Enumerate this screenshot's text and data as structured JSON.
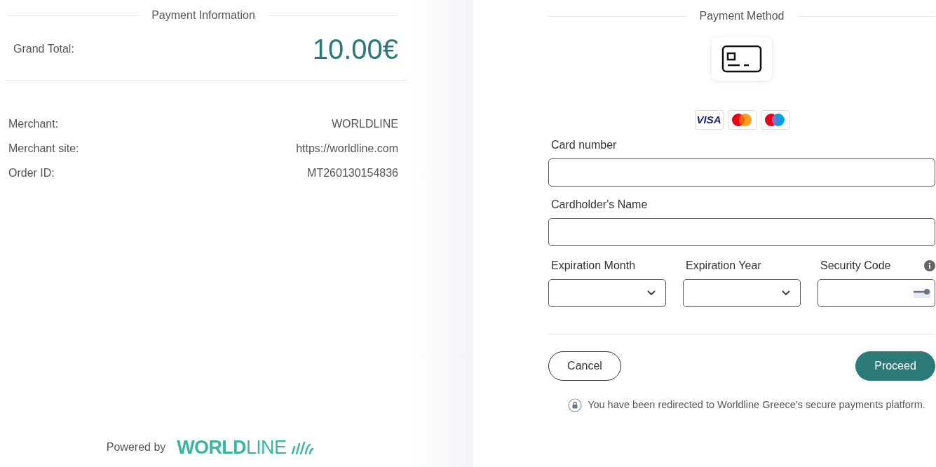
{
  "payment_information": {
    "heading": "Payment Information",
    "grand_total": {
      "label": "Grand Total:",
      "amount": "10.00€"
    },
    "details": [
      {
        "label": "Merchant:",
        "value": "WORLDLINE"
      },
      {
        "label": "Merchant site:",
        "value": "https://worldline.com"
      },
      {
        "label": "Order ID:",
        "value": "MT260130154836"
      }
    ],
    "footer": {
      "prefix": "Powered by",
      "logo": "**WORLD**LINE"
    }
  },
  "payment_method": {
    "heading": "Payment Method",
    "card_brands": [
      {
        "kind": "visa",
        "label": "VISA"
      },
      {
        "kind": "mastercard"
      },
      {
        "kind": "maestro"
      }
    ],
    "fields": [
      {
        "kind": "text",
        "label": "Card number"
      },
      {
        "kind": "text",
        "label": "Cardholder's Name"
      }
    ],
    "expiry_fields": [
      {
        "kind": "select",
        "label": "Expiration Month"
      },
      {
        "kind": "select",
        "label": "Expiration Year"
      },
      {
        "kind": "cvv",
        "label": "Security Code"
      }
    ],
    "buttons": [
      {
        "kind": "secondary",
        "label": "Cancel"
      },
      {
        "kind": "primary",
        "label": "Proceed"
      }
    ],
    "notice": "You have been redirected to Worldline Greece’s secure payments platform."
  }
}
